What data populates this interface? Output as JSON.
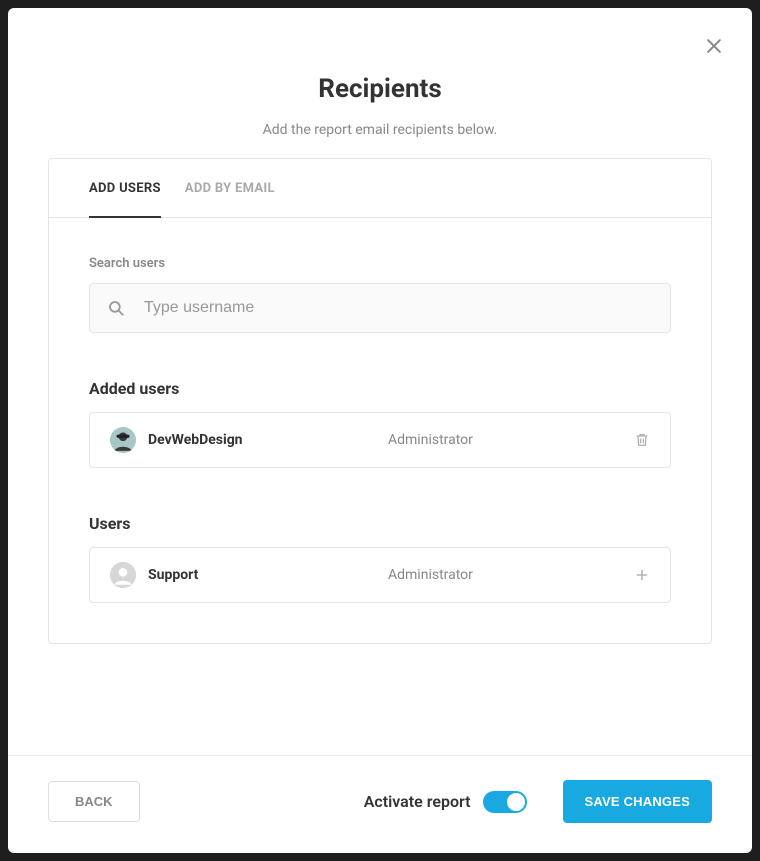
{
  "header": {
    "title": "Recipients",
    "subtitle": "Add the report email recipients below."
  },
  "tabs": {
    "add_users": "ADD USERS",
    "add_by_email": "ADD BY EMAIL"
  },
  "search": {
    "label": "Search users",
    "placeholder": "Type username"
  },
  "added": {
    "title": "Added users",
    "items": [
      {
        "name": "DevWebDesign",
        "role": "Administrator"
      }
    ]
  },
  "users": {
    "title": "Users",
    "items": [
      {
        "name": "Support",
        "role": "Administrator"
      }
    ]
  },
  "footer": {
    "back": "BACK",
    "toggle_label": "Activate report",
    "toggle_on": true,
    "save": "SAVE CHANGES"
  },
  "colors": {
    "accent": "#17a9e0"
  }
}
